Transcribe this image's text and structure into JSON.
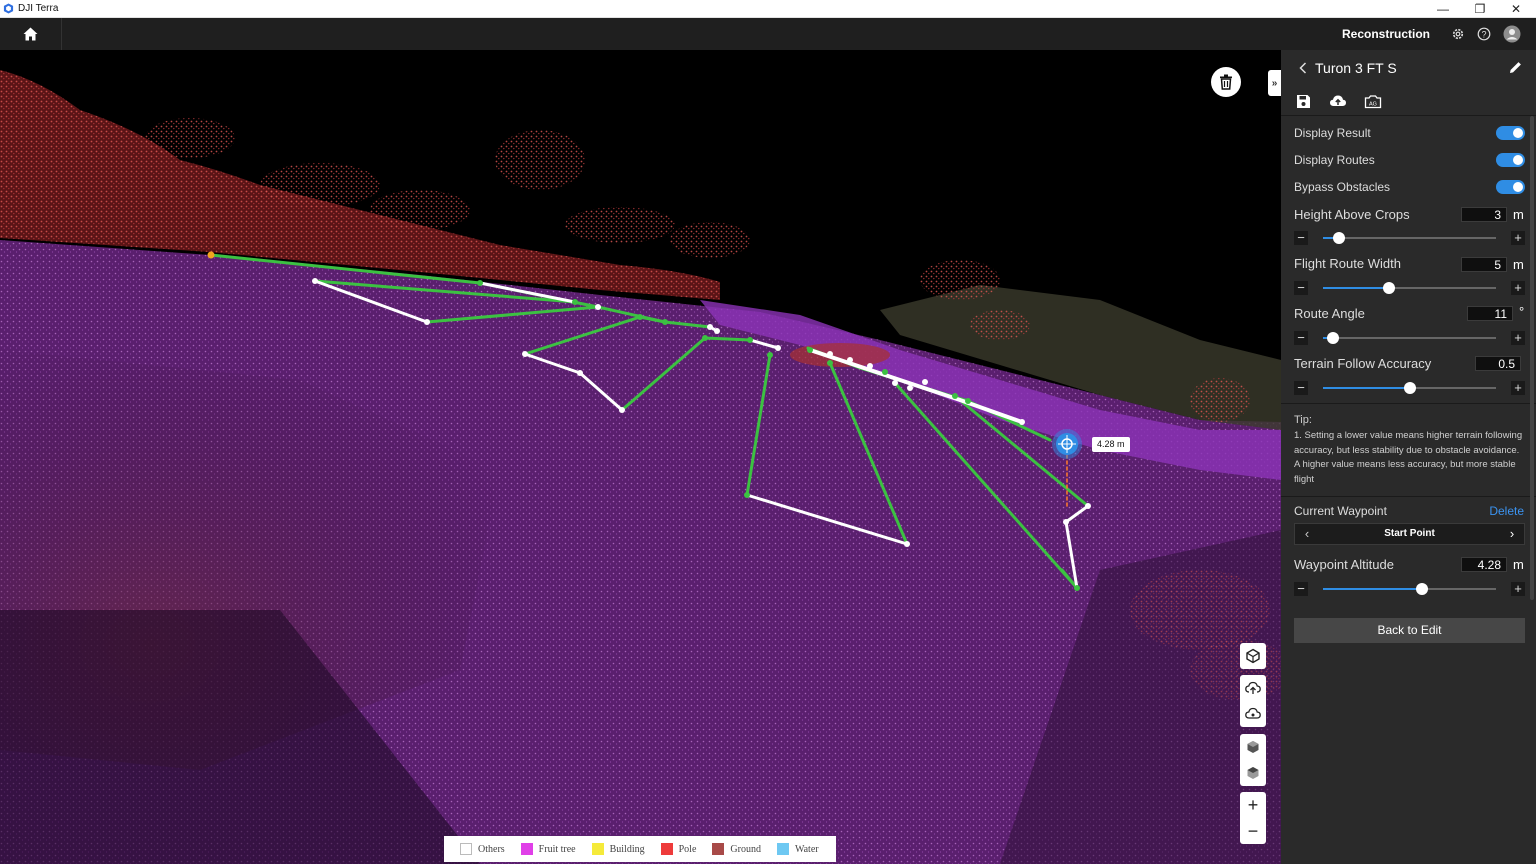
{
  "window": {
    "title": "DJI Terra",
    "controls": [
      "—",
      "❐",
      "✕"
    ]
  },
  "appbar": {
    "title": "Reconstruction",
    "icons": [
      "home-icon",
      "gear-icon",
      "help-icon",
      "user-avatar-icon"
    ]
  },
  "viewport": {
    "distance_label": "4.28 m",
    "tools": [
      "trash-icon",
      "collapse-panel-icon",
      "3d-view-icon",
      "upload-cloud-icon",
      "cloud-sync-icon",
      "cube-front-icon",
      "cube-top-icon",
      "zoom-in-icon",
      "zoom-out-icon"
    ],
    "collapse_label": "»",
    "zoom_in": "+",
    "zoom_out": "−"
  },
  "legend": [
    {
      "label": "Others",
      "color": "#ffffff"
    },
    {
      "label": "Fruit tree",
      "color": "#e040e8"
    },
    {
      "label": "Building",
      "color": "#f5ea3a"
    },
    {
      "label": "Pole",
      "color": "#ee3b3b"
    },
    {
      "label": "Ground",
      "color": "#a84a48"
    },
    {
      "label": "Water",
      "color": "#6ec8f2"
    }
  ],
  "panel": {
    "title": "Turon 3 FT S",
    "toolbar_icons": [
      "save-icon",
      "upload-icon",
      "ai-camera-icon"
    ],
    "toggles": [
      {
        "label": "Display Result",
        "on": true
      },
      {
        "label": "Display Routes",
        "on": true
      },
      {
        "label": "Bypass Obstacles",
        "on": true
      }
    ],
    "params": [
      {
        "label": "Height Above Crops",
        "value": "3",
        "unit": "m",
        "fraction": 0.09
      },
      {
        "label": "Flight Route Width",
        "value": "5",
        "unit": "m",
        "fraction": 0.38
      },
      {
        "label": "Route Angle",
        "value": "11",
        "unit": "°",
        "fraction": 0.06
      },
      {
        "label": "Terrain Follow Accuracy",
        "value": "0.5",
        "unit": "",
        "fraction": 0.5
      }
    ],
    "minus": "−",
    "plus": "+",
    "tip_title": "Tip:",
    "tip_text": "1. Setting a lower value means higher terrain following accuracy, but less stability due to obstacle avoidance. A higher value means less accuracy, but more stable flight",
    "current_waypoint_label": "Current Waypoint",
    "delete_label": "Delete",
    "waypoint_name": "Start Point",
    "prev_arrow": "‹",
    "next_arrow": "›",
    "altitude": {
      "label": "Waypoint Altitude",
      "value": "4.28",
      "unit": "m",
      "fraction": 0.57
    },
    "back_button": "Back to Edit"
  },
  "colors": {
    "accent": "#2f8de4",
    "route_green": "#3cc142",
    "route_white": "#ffffff",
    "panel_bg": "#2a2a2a",
    "appbar_bg": "#1f1f1f"
  }
}
